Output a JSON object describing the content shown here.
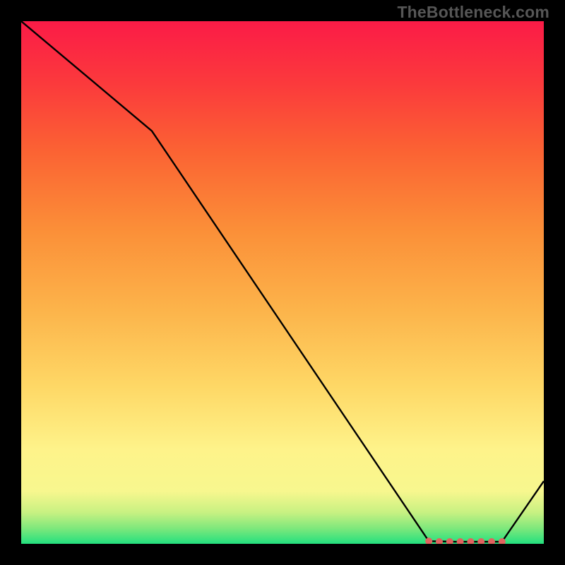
{
  "watermark": "TheBottleneck.com",
  "chart_data": {
    "type": "line",
    "title": "",
    "xlabel": "",
    "ylabel": "",
    "xlim": [
      0,
      100
    ],
    "ylim": [
      0,
      100
    ],
    "x": [
      0,
      25,
      78,
      83,
      92,
      100
    ],
    "values": [
      100,
      79,
      0.5,
      0.4,
      0.4,
      12
    ],
    "markers": {
      "x": [
        78,
        80,
        82,
        84,
        86,
        88,
        90,
        92
      ],
      "values": [
        0.5,
        0.4,
        0.4,
        0.4,
        0.4,
        0.4,
        0.4,
        0.4
      ]
    },
    "background_gradient_stops": [
      {
        "pos": 0.0,
        "color": "#23e07e"
      },
      {
        "pos": 0.03,
        "color": "#7fe87c"
      },
      {
        "pos": 0.06,
        "color": "#c8f182"
      },
      {
        "pos": 0.1,
        "color": "#f7f78e"
      },
      {
        "pos": 0.18,
        "color": "#fef38a"
      },
      {
        "pos": 0.3,
        "color": "#fed866"
      },
      {
        "pos": 0.45,
        "color": "#fcb34a"
      },
      {
        "pos": 0.6,
        "color": "#fb8f38"
      },
      {
        "pos": 0.75,
        "color": "#fb6333"
      },
      {
        "pos": 0.88,
        "color": "#fb3a3c"
      },
      {
        "pos": 1.0,
        "color": "#fb1b47"
      }
    ],
    "line_color": "#000000",
    "marker_color": "#e1635f"
  }
}
